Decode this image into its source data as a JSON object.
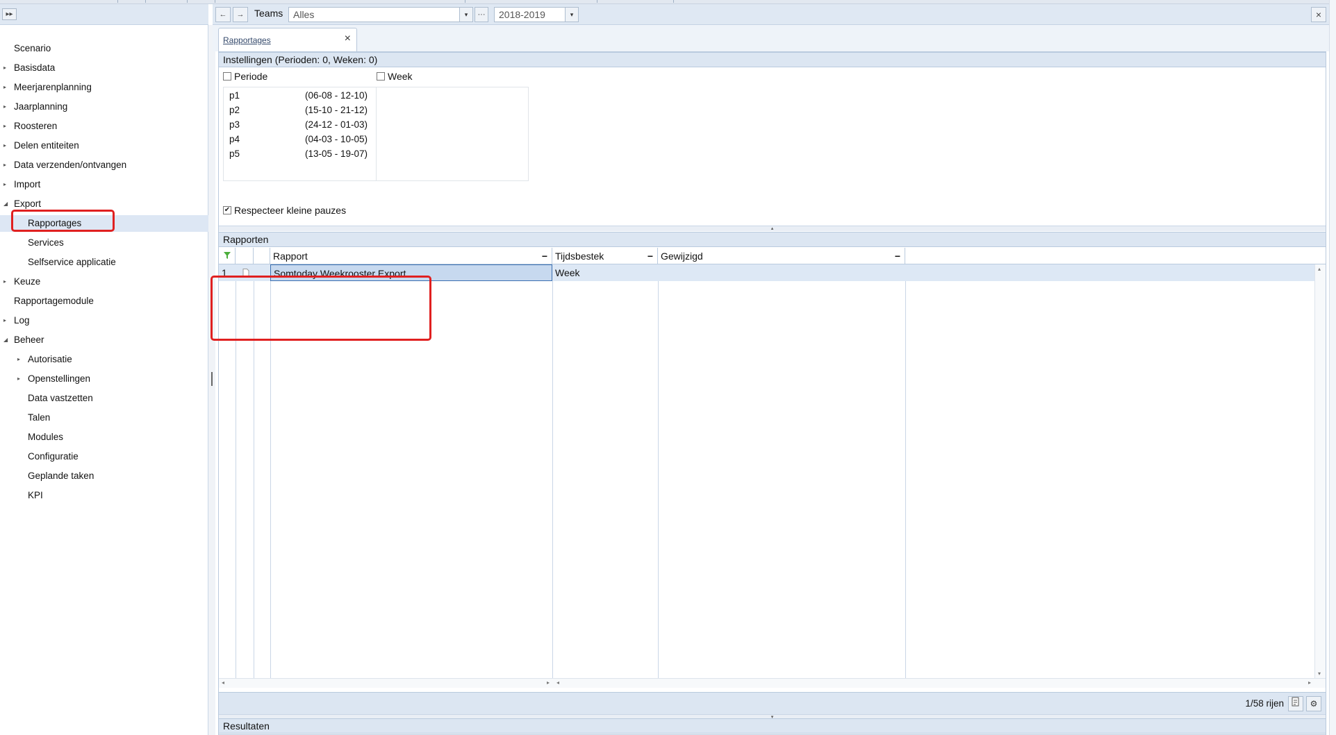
{
  "nav": {
    "items": [
      {
        "label": "Scenario",
        "arrow": ""
      },
      {
        "label": "Basisdata",
        "arrow": "▸"
      },
      {
        "label": "Meerjarenplanning",
        "arrow": "▸"
      },
      {
        "label": "Jaarplanning",
        "arrow": "▸"
      },
      {
        "label": "Roosteren",
        "arrow": "▸"
      },
      {
        "label": "Delen entiteiten",
        "arrow": "▸"
      },
      {
        "label": "Data verzenden/ontvangen",
        "arrow": "▸"
      },
      {
        "label": "Import",
        "arrow": "▸"
      },
      {
        "label": "Export",
        "arrow": "◢"
      },
      {
        "label": "Rapportages",
        "arrow": ""
      },
      {
        "label": "Services",
        "arrow": ""
      },
      {
        "label": "Selfservice applicatie",
        "arrow": ""
      },
      {
        "label": "Keuze",
        "arrow": "▸"
      },
      {
        "label": "Rapportagemodule",
        "arrow": ""
      },
      {
        "label": "Log",
        "arrow": "▸"
      },
      {
        "label": "Beheer",
        "arrow": "◢"
      },
      {
        "label": "Autorisatie",
        "arrow": "▸"
      },
      {
        "label": "Openstellingen",
        "arrow": "▸"
      },
      {
        "label": "Data vastzetten",
        "arrow": ""
      },
      {
        "label": "Talen",
        "arrow": ""
      },
      {
        "label": "Modules",
        "arrow": ""
      },
      {
        "label": "Configuratie",
        "arrow": ""
      },
      {
        "label": "Geplande taken",
        "arrow": ""
      },
      {
        "label": "KPI",
        "arrow": ""
      }
    ],
    "selected": "Rapportages"
  },
  "toolbar": {
    "expand_icon": "▸▸",
    "back_icon": "←",
    "forward_icon": "→",
    "teams_label": "Teams",
    "teams_value": "Alles",
    "dropdown_icon": "▾",
    "more_icon": "···",
    "year_value": "2018-2019",
    "close_icon": "×"
  },
  "tab": {
    "label": "Rapportages",
    "close_icon": "×"
  },
  "settings": {
    "header": "Instellingen (Perioden: 0, Weken: 0)",
    "periode_label": "Periode",
    "week_label": "Week",
    "periods": [
      {
        "name": "p1",
        "dates": "(06-08 - 12-10)"
      },
      {
        "name": "p2",
        "dates": "(15-10 - 21-12)"
      },
      {
        "name": "p3",
        "dates": "(24-12 - 01-03)"
      },
      {
        "name": "p4",
        "dates": "(04-03 - 10-05)"
      },
      {
        "name": "p5",
        "dates": "(13-05 - 19-07)"
      }
    ],
    "respect_label": "Respecteer kleine pauzes",
    "respect_checked": true,
    "check_mark": "✔"
  },
  "reports": {
    "header": "Rapporten",
    "columns": {
      "filter_icon": "funnel-icon",
      "rapport": "Rapport",
      "tijdsbestek": "Tijdsbestek",
      "gewijzigd": "Gewijzigd",
      "collapse_icon": "−"
    },
    "rows": [
      {
        "num": "1",
        "rapport": "Somtoday Weekrooster Export",
        "tijdsbestek": "Week",
        "gewijzigd": ""
      }
    ],
    "row_count": "1/58 rijen"
  },
  "results": {
    "header": "Resultaten"
  },
  "colors": {
    "accent": "#e02020",
    "header_bg": "#dce6f2",
    "selection": "#c7d9ef"
  }
}
